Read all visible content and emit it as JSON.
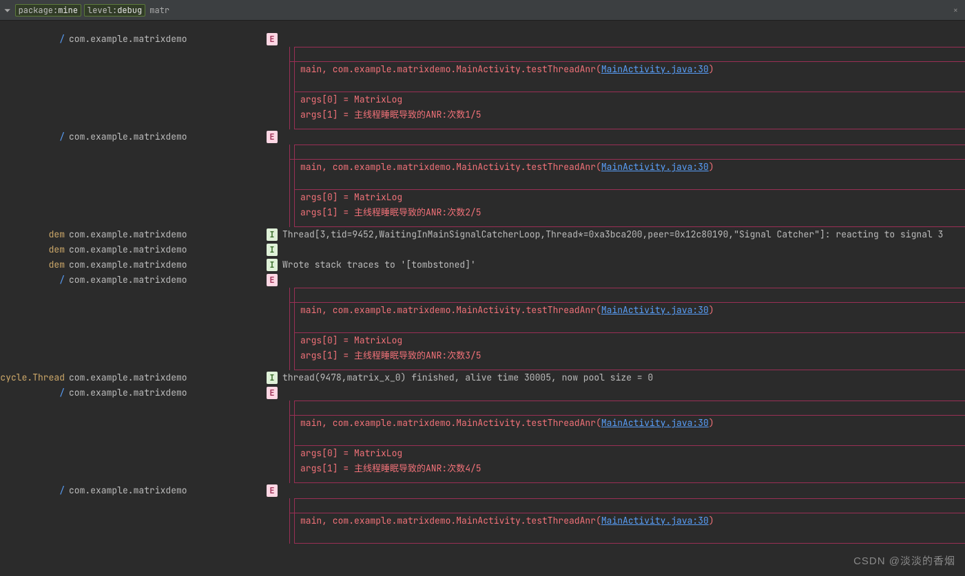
{
  "filterbar": {
    "chip1_key": "package:",
    "chip1_val": "mine",
    "chip2_key": "level:",
    "chip2_val": "debug",
    "text": "matr",
    "close": "×"
  },
  "levels": {
    "E": "E",
    "I": "I"
  },
  "pkg": "com.example.matrixdemo",
  "tags": {
    "slash": "/",
    "dem": "dem",
    "cycleThread": "cycle.Thread"
  },
  "err": {
    "stack_pre": "main, com.example.matrixdemo.MainActivity.testThreadAnr(",
    "link": "MainActivity.java:30",
    "stack_post": ")",
    "args0": "args[0] = MatrixLog",
    "args1_1": "args[1] = 主线程睡眠导致的ANR:次数1/5",
    "args1_2": "args[1] = 主线程睡眠导致的ANR:次数2/5",
    "args1_3": "args[1] = 主线程睡眠导致的ANR:次数3/5",
    "args1_4": "args[1] = 主线程睡眠导致的ANR:次数4/5"
  },
  "info": {
    "thread_react": "Thread[3,tid=9452,WaitingInMainSignalCatcherLoop,Thread*=0xa3bca200,peer=0x12c80190,\"Signal Catcher\"]: reacting to signal 3",
    "tombstoned": "Wrote stack traces to '[tombstoned]'",
    "pool": "thread(9478,matrix_x_0) finished, alive time 30005, now pool size = 0"
  },
  "watermark": "CSDN @淡淡的香烟"
}
